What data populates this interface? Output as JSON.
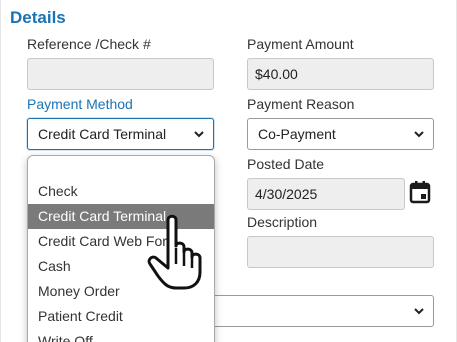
{
  "section": {
    "title": "Details"
  },
  "fields": {
    "reference_label": "Reference /Check #",
    "reference_value": "",
    "amount_label": "Payment Amount",
    "amount_value": "$40.00",
    "method_label": "Payment Method",
    "method_value": "Credit Card Terminal",
    "reason_label": "Payment Reason",
    "reason_value": "Co-Payment",
    "posted_label": "Posted Date",
    "posted_value": "4/30/2025",
    "description_label": "Description",
    "description_value": ""
  },
  "dropdown": {
    "options": [
      "Check",
      "Credit Card Terminal",
      "Credit Card Web Form",
      "Cash",
      "Money Order",
      "Patient Credit",
      "Write Off"
    ],
    "selected": "Credit Card Terminal"
  },
  "colors": {
    "accent": "#1a73b5",
    "selected_bg": "#7a7a7a",
    "readonly_bg": "#eeeeee"
  },
  "icons": {
    "calendar": "calendar-icon",
    "chevron": "chevron-down-icon",
    "cursor": "hand-pointer-cursor"
  }
}
